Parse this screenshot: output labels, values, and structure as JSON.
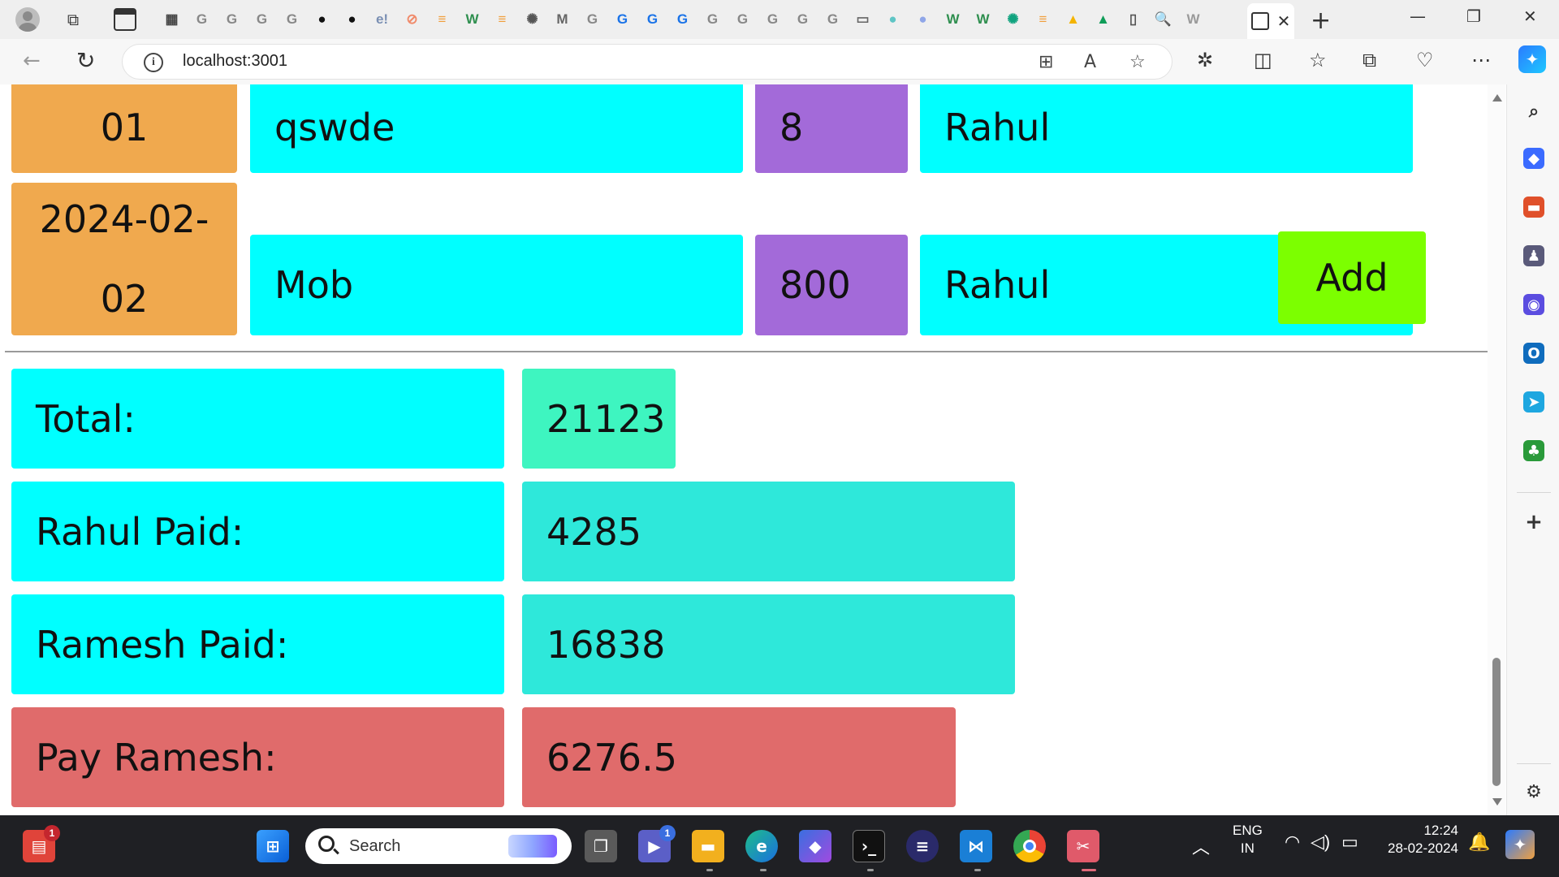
{
  "browser": {
    "address": "localhost:3001",
    "tab_icons": [
      {
        "icon": "calendar-icon",
        "glyph": "▦",
        "color": "#444444"
      },
      {
        "icon": "google-icon",
        "glyph": "G",
        "color": "#888888"
      },
      {
        "icon": "google-icon",
        "glyph": "G",
        "color": "#888888"
      },
      {
        "icon": "google-icon",
        "glyph": "G",
        "color": "#888888"
      },
      {
        "icon": "google-icon",
        "glyph": "G",
        "color": "#888888"
      },
      {
        "icon": "github-icon",
        "glyph": "●",
        "color": "#111111"
      },
      {
        "icon": "github-icon",
        "glyph": "●",
        "color": "#111111"
      },
      {
        "icon": "e-icon",
        "glyph": "e!",
        "color": "#7a8fb3"
      },
      {
        "icon": "slash-circle-icon",
        "glyph": "⊘",
        "color": "#f08a6a"
      },
      {
        "icon": "stack-icon",
        "glyph": "≡",
        "color": "#f0a040"
      },
      {
        "icon": "w-icon",
        "glyph": "W",
        "color": "#2f8f4f"
      },
      {
        "icon": "stack-icon",
        "glyph": "≡",
        "color": "#f0a040"
      },
      {
        "icon": "chatgpt-icon",
        "glyph": "✺",
        "color": "#555555"
      },
      {
        "icon": "m-icon",
        "glyph": "M",
        "color": "#666666"
      },
      {
        "icon": "google-icon",
        "glyph": "G",
        "color": "#888888"
      },
      {
        "icon": "google-icon",
        "glyph": "G",
        "color": "#1a73e8"
      },
      {
        "icon": "google-icon",
        "glyph": "G",
        "color": "#1a73e8"
      },
      {
        "icon": "google-icon",
        "glyph": "G",
        "color": "#1a73e8"
      },
      {
        "icon": "google-icon",
        "glyph": "G",
        "color": "#888888"
      },
      {
        "icon": "google-icon",
        "glyph": "G",
        "color": "#888888"
      },
      {
        "icon": "google-icon",
        "glyph": "G",
        "color": "#888888"
      },
      {
        "icon": "google-icon",
        "glyph": "G",
        "color": "#888888"
      },
      {
        "icon": "google-icon",
        "glyph": "G",
        "color": "#888888"
      },
      {
        "icon": "reader-icon",
        "glyph": "▭",
        "color": "#666666"
      },
      {
        "icon": "circle-app-icon",
        "glyph": "●",
        "color": "#5fc5c5"
      },
      {
        "icon": "circle-app-icon",
        "glyph": "●",
        "color": "#8fa6e8"
      },
      {
        "icon": "w-icon",
        "glyph": "W",
        "color": "#2f8f4f"
      },
      {
        "icon": "w-icon",
        "glyph": "W",
        "color": "#2f8f4f"
      },
      {
        "icon": "chatgpt-icon",
        "glyph": "✺",
        "color": "#10a37f"
      },
      {
        "icon": "stack-icon",
        "glyph": "≡",
        "color": "#f0a040"
      },
      {
        "icon": "drive-icon",
        "glyph": "▲",
        "color": "#f4b400"
      },
      {
        "icon": "drive-icon",
        "glyph": "▲",
        "color": "#0f9d58"
      },
      {
        "icon": "page-icon",
        "glyph": "▯",
        "color": "#555555"
      },
      {
        "icon": "search-icon",
        "glyph": "🔍",
        "color": "#1a73e8"
      },
      {
        "icon": "w-icon",
        "glyph": "W",
        "color": "#9a9a9a"
      }
    ]
  },
  "expenses": {
    "rows": [
      {
        "date": "01",
        "item": "qswde",
        "amount": "8",
        "payer": "Rahul"
      },
      {
        "date": "2024-02-02",
        "item": "Mob",
        "amount": "800",
        "payer": "Rahul"
      }
    ],
    "add_label": "Add"
  },
  "summary": {
    "total_label": "Total:",
    "total_value": "21123",
    "rahul_label": "Rahul Paid:",
    "rahul_value": "4285",
    "ramesh_label": "Ramesh Paid:",
    "ramesh_value": "16838",
    "pay_label": "Pay Ramesh:",
    "pay_value": "6276.5"
  },
  "colors": {
    "date_cell": "#f0a94e",
    "text_cell": "#00ffff",
    "amount_cell": "#a36ad9",
    "add_button": "#7cff00",
    "total_value": "#3ef5c0",
    "paid_value": "#2ee8da",
    "pay_cell": "#e06b6b"
  },
  "taskbar": {
    "search_placeholder": "Search",
    "widgets_badge": "1",
    "teams_badge": "1",
    "language": "ENG",
    "region": "IN",
    "time": "12:24",
    "date": "28-02-2024"
  }
}
